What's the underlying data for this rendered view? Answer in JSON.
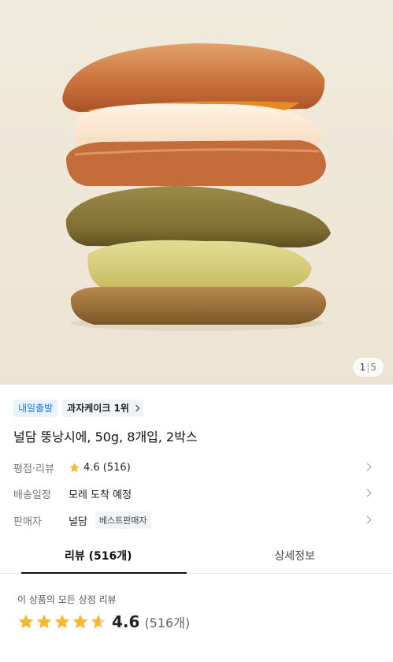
{
  "image": {
    "counter_current": "1",
    "counter_sep": "|",
    "counter_total": "5"
  },
  "badges": {
    "delivery": "내일출발",
    "rank": "과자케이크 1위"
  },
  "product": {
    "title": "널담 뚱낭시에, 50g, 8개입, 2박스"
  },
  "info": {
    "rating_label": "평점·리뷰",
    "rating_value": "4.6 (516)",
    "shipping_label": "배송일정",
    "shipping_value": "모레 도착 예정",
    "seller_label": "판매자",
    "seller_value": "널담",
    "seller_badge": "베스트판매자"
  },
  "tabs": [
    {
      "label": "리뷰 (516개)"
    },
    {
      "label": "상세정보"
    }
  ],
  "review_summary": {
    "caption": "이 상품의 모든 상점 리뷰",
    "score": "4.6",
    "count": "(516개)",
    "rating": 4.6
  },
  "colors": {
    "star": "#f7b731",
    "star_empty": "#d9d9d9",
    "accent_blue": "#1f73d6"
  }
}
